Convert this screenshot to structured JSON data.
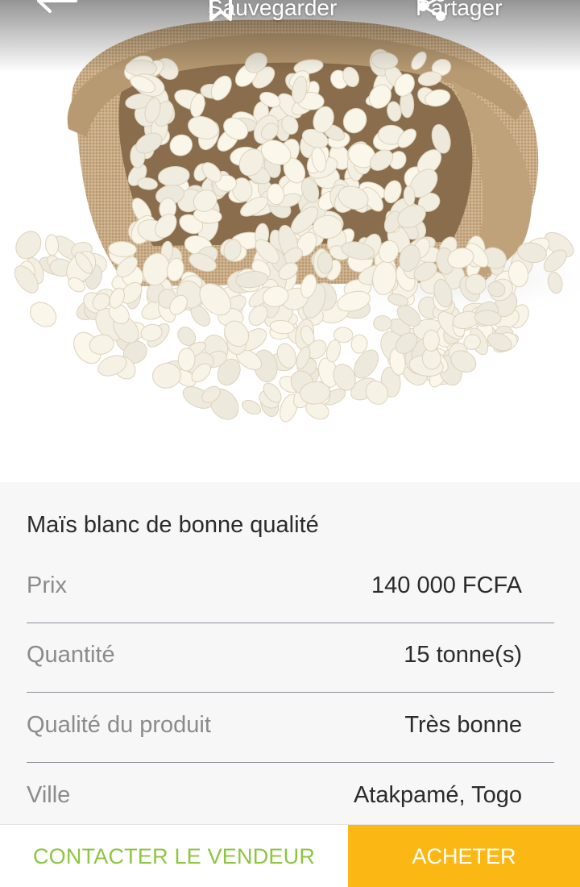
{
  "header": {
    "back_icon": "arrow-left-icon",
    "save_label": "Sauvegarder",
    "save_icon": "bookmark-icon",
    "share_label": "Partager",
    "share_icon": "share-icon"
  },
  "product": {
    "title": "Maïs blanc de bonne qualité",
    "details": [
      {
        "label": "Prix",
        "value": "140 000 FCFA"
      },
      {
        "label": "Quantité",
        "value": "15 tonne(s)"
      },
      {
        "label": "Qualité du produit",
        "value": "Très bonne"
      },
      {
        "label": "Ville",
        "value": "Atakpamé, Togo"
      }
    ]
  },
  "actions": {
    "contact_label": "CONTACTER LE VENDEUR",
    "buy_label": "ACHETER"
  },
  "colors": {
    "accent_green": "#8dc63f",
    "accent_yellow": "#fbb714"
  }
}
